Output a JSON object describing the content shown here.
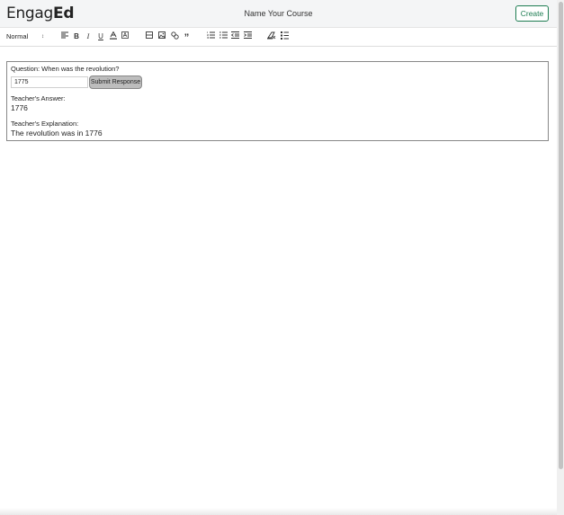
{
  "navbar": {
    "logo_regular": "Engag",
    "logo_bold": "Ed",
    "course_name": "Name Your Course",
    "create_label": "Create"
  },
  "toolbar": {
    "heading_select": "Normal",
    "heading_arrows": "↕",
    "buttons": [
      {
        "name": "align-icon",
        "glyph": "align"
      },
      {
        "name": "bold-icon",
        "glyph": "B"
      },
      {
        "name": "italic-icon",
        "glyph": "I"
      },
      {
        "name": "underline-icon",
        "glyph": "U"
      },
      {
        "name": "text-color-icon",
        "glyph": "A"
      },
      {
        "name": "background-color-icon",
        "glyph": "A"
      },
      {
        "name": "formula-icon",
        "glyph": "formula"
      },
      {
        "name": "image-icon",
        "glyph": "image"
      },
      {
        "name": "link-icon",
        "glyph": "link"
      },
      {
        "name": "quote-icon",
        "glyph": "”"
      },
      {
        "name": "ordered-list-icon",
        "glyph": "ol"
      },
      {
        "name": "bullet-list-icon",
        "glyph": "ul"
      },
      {
        "name": "indent-decrease-icon",
        "glyph": "outdent"
      },
      {
        "name": "indent-increase-icon",
        "glyph": "indent"
      },
      {
        "name": "clear-format-icon",
        "glyph": "clean"
      },
      {
        "name": "question-block-icon",
        "glyph": "list-check"
      }
    ]
  },
  "question_block": {
    "question_label": "Question: When was the revolution?",
    "answer_value": "1775",
    "submit_label": "Submit Response",
    "teacher_answer_label": "Teacher's Answer:",
    "teacher_answer_value": "1776",
    "teacher_explanation_label": "Teacher's Explanation:",
    "teacher_explanation_value": "The revolution was in 1776"
  },
  "colors": {
    "accent_green": "#1e7d52",
    "navbar_bg": "#f4f5f6",
    "submit_bg": "#bdbdbd"
  }
}
